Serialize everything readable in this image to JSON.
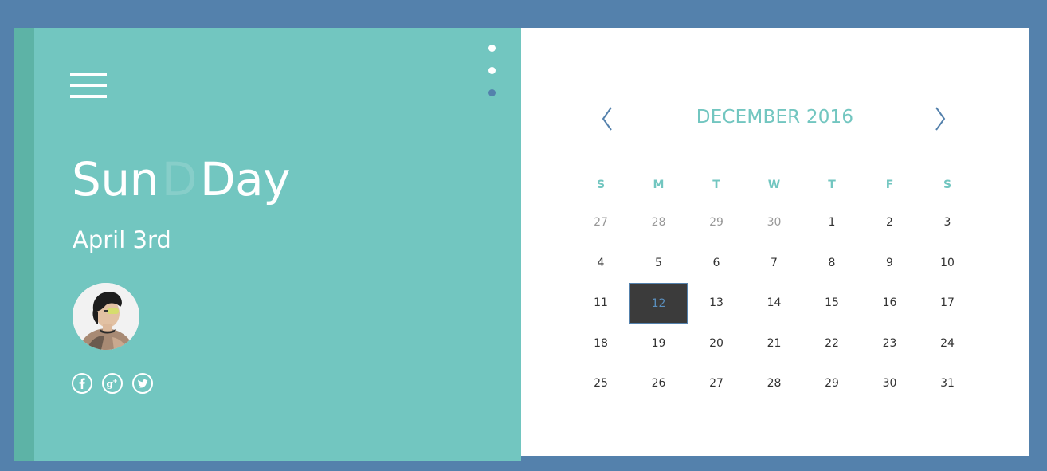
{
  "left_panel": {
    "title_part1": "Sun",
    "title_ghost": "D",
    "title_part2": "Day",
    "date": "April 3rd",
    "social_icons": [
      "facebook-icon",
      "google-plus-icon",
      "twitter-icon"
    ]
  },
  "calendar": {
    "month_label": "DECEMBER 2016",
    "weekdays": [
      "S",
      "M",
      "T",
      "W",
      "T",
      "F",
      "S"
    ],
    "weeks": [
      [
        {
          "day": "27",
          "muted": true
        },
        {
          "day": "28",
          "muted": true
        },
        {
          "day": "29",
          "muted": true
        },
        {
          "day": "30",
          "muted": true
        },
        {
          "day": "1"
        },
        {
          "day": "2"
        },
        {
          "day": "3"
        }
      ],
      [
        {
          "day": "4"
        },
        {
          "day": "5"
        },
        {
          "day": "6"
        },
        {
          "day": "7"
        },
        {
          "day": "8"
        },
        {
          "day": "9"
        },
        {
          "day": "10"
        }
      ],
      [
        {
          "day": "11"
        },
        {
          "day": "12",
          "selected": true
        },
        {
          "day": "13"
        },
        {
          "day": "14"
        },
        {
          "day": "15"
        },
        {
          "day": "16"
        },
        {
          "day": "17"
        }
      ],
      [
        {
          "day": "18"
        },
        {
          "day": "19"
        },
        {
          "day": "20"
        },
        {
          "day": "21"
        },
        {
          "day": "22"
        },
        {
          "day": "23"
        },
        {
          "day": "24"
        }
      ],
      [
        {
          "day": "25"
        },
        {
          "day": "26"
        },
        {
          "day": "27"
        },
        {
          "day": "28"
        },
        {
          "day": "29"
        },
        {
          "day": "30"
        },
        {
          "day": "31"
        }
      ]
    ]
  },
  "colors": {
    "background": "#5481ac",
    "accent": "#72c6c0",
    "accent_dark": "#5db3a6",
    "selected_bg": "#3b3b3b",
    "selected_text": "#5a8fbe",
    "active_dot": "#5481ac"
  }
}
